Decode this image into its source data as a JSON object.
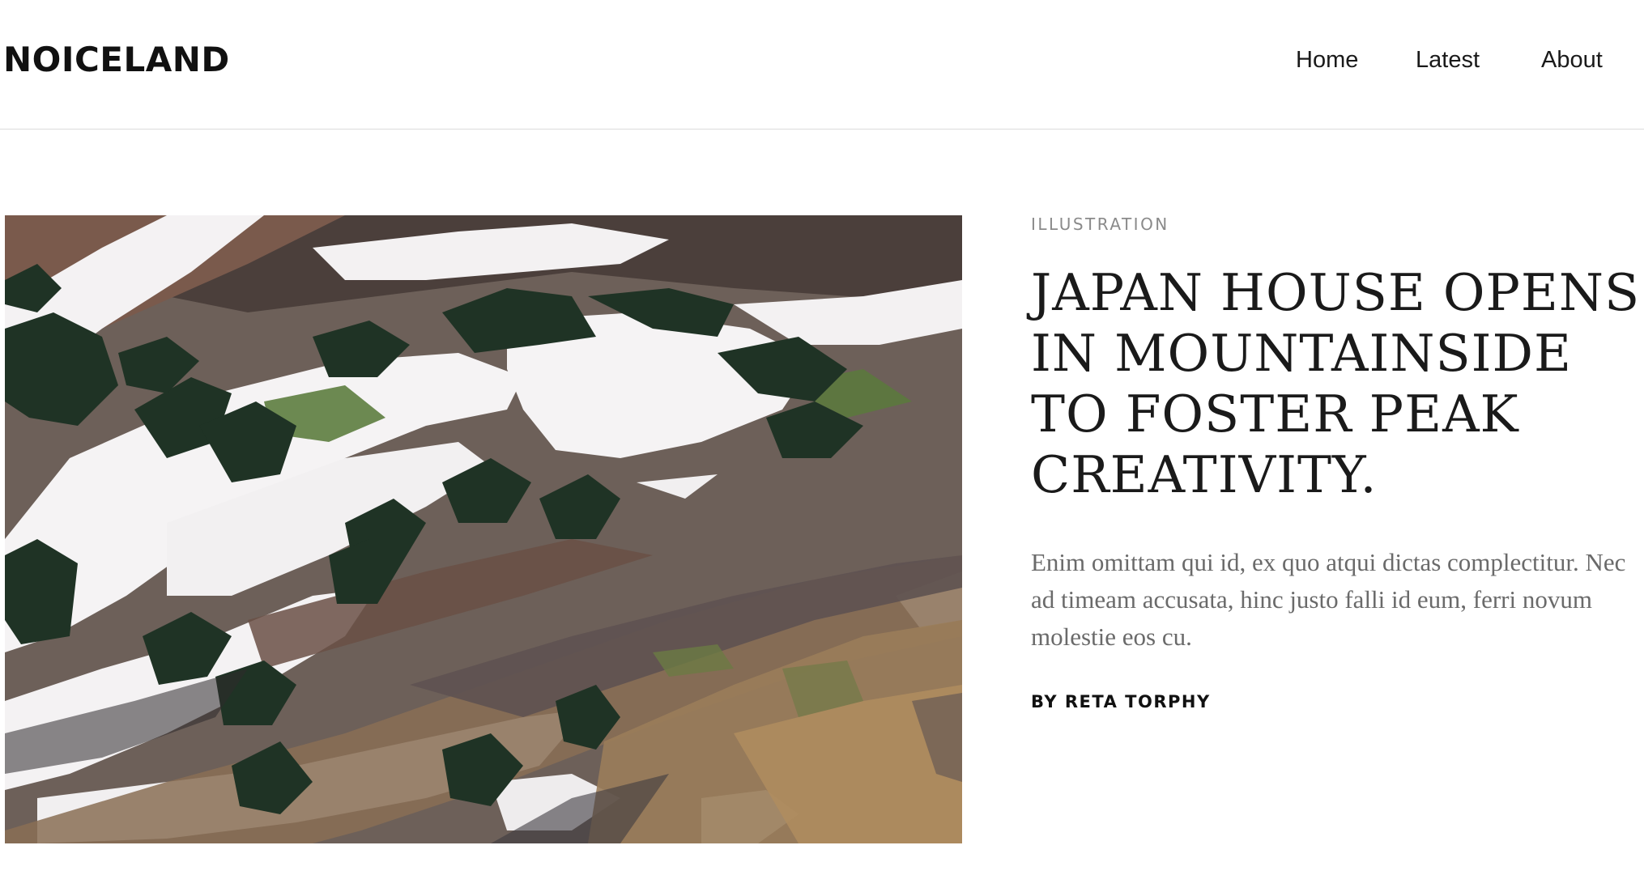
{
  "site": {
    "logo": "NOICELAND"
  },
  "nav": {
    "items": [
      {
        "label": "Home"
      },
      {
        "label": "Latest"
      },
      {
        "label": "About"
      }
    ]
  },
  "hero": {
    "image": "mountain-hillside-snow-photo"
  },
  "article": {
    "category": "ILLUSTRATION",
    "title": "JAPAN HOUSE OPENS IN MOUNTAINSIDE TO FOSTER PEAK CREATIVITY.",
    "excerpt": "Enim omittam qui id, ex quo atqui dictas complectitur. Nec ad timeam accusata, hinc justo falli id eum, ferri novum molestie eos cu.",
    "byline": "BY RETA TORPHY"
  },
  "colors": {
    "text": "#1a1a1a",
    "muted": "#8a8a8a",
    "excerpt": "#6a6a6a",
    "divider": "#dcdcdc",
    "background": "#ffffff"
  }
}
